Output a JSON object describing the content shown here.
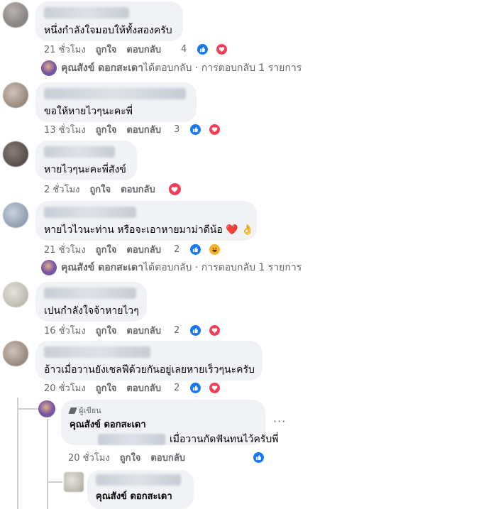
{
  "comments": [
    {
      "text": "หนึ่งกำลังใจมอบให้ทั้งสองครับ",
      "time": "21 ชั่วโมง",
      "like": "ถูกใจ",
      "reply": "ตอบกลับ",
      "count": "4",
      "reactions": [
        "like",
        "love"
      ]
    },
    {
      "text": "ขอให้หายไวๆนะคะพี่",
      "time": "13 ชั่วโมง",
      "like": "ถูกใจ",
      "reply": "ตอบกลับ",
      "count": "3",
      "reactions": [
        "like",
        "love"
      ]
    },
    {
      "text": "หายไวๆนะคะพี่สังข์",
      "time": "2 ชั่วโมง",
      "like": "ถูกใจ",
      "reply": "ตอบกลับ",
      "count": "",
      "reactions": [
        "love"
      ]
    },
    {
      "text": "หายไวไวนะท่าน หรือจะเอาหายมาม่าดีน้อ",
      "emoji": "❤️ 👌",
      "time": "21 ชั่วโมง",
      "like": "ถูกใจ",
      "reply": "ตอบกลับ",
      "count": "2",
      "reactions": [
        "like",
        "haha"
      ]
    },
    {
      "text": "เปนกำลังใจจ้าหายไวๆ",
      "time": "16 ชั่วโมง",
      "like": "ถูกใจ",
      "reply": "ตอบกลับ",
      "count": "2",
      "reactions": [
        "like",
        "love"
      ]
    },
    {
      "text": "อ้าวเมื่อวานยังเชลฟีด้วยกันอยู่เลยหายเร็วๆนะครับ",
      "time": "20 ชั่วโมง",
      "like": "ถูกใจ",
      "reply": "ตอบกลับ",
      "count": "2",
      "reactions": [
        "like",
        "love"
      ]
    }
  ],
  "replies_summary": {
    "name": "คุณสังข์ ดอกสะเดา",
    "text": " ได้ตอบกลับ · การตอบกลับ 1 รายการ"
  },
  "author_reply": {
    "badge": "ผู้เขียน",
    "name": "คุณสังข์ ดอกสะเดา",
    "text": "เมื่อวานกัดฟันทนไว้ครับพี่",
    "time": "20 ชั่วโมง",
    "like": "ถูกใจ",
    "reply": "ตอบกลับ",
    "menu": "···"
  },
  "nested_reply": {
    "name": "คุณสังข์ ดอกสะเดา"
  },
  "colors": {
    "like": "#1877f2",
    "love": "#f33e58",
    "haha": "#f7b125",
    "bubble": "#f0f2f5"
  }
}
